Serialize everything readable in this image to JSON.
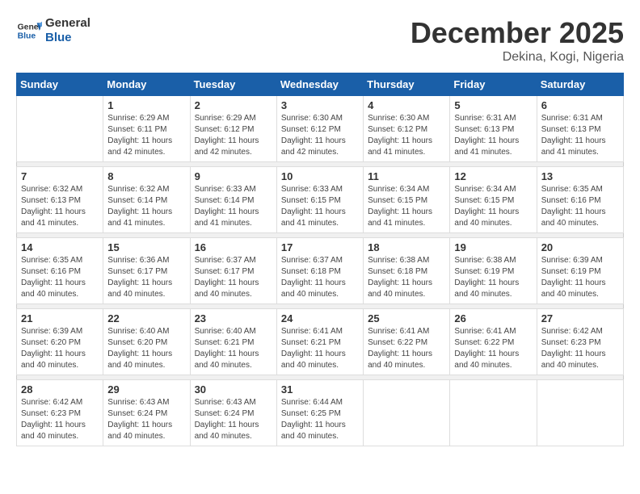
{
  "logo": {
    "line1": "General",
    "line2": "Blue"
  },
  "title": "December 2025",
  "location": "Dekina, Kogi, Nigeria",
  "days_of_week": [
    "Sunday",
    "Monday",
    "Tuesday",
    "Wednesday",
    "Thursday",
    "Friday",
    "Saturday"
  ],
  "weeks": [
    [
      {
        "day": "",
        "info": ""
      },
      {
        "day": "1",
        "info": "Sunrise: 6:29 AM\nSunset: 6:11 PM\nDaylight: 11 hours and 42 minutes."
      },
      {
        "day": "2",
        "info": "Sunrise: 6:29 AM\nSunset: 6:12 PM\nDaylight: 11 hours and 42 minutes."
      },
      {
        "day": "3",
        "info": "Sunrise: 6:30 AM\nSunset: 6:12 PM\nDaylight: 11 hours and 42 minutes."
      },
      {
        "day": "4",
        "info": "Sunrise: 6:30 AM\nSunset: 6:12 PM\nDaylight: 11 hours and 41 minutes."
      },
      {
        "day": "5",
        "info": "Sunrise: 6:31 AM\nSunset: 6:13 PM\nDaylight: 11 hours and 41 minutes."
      },
      {
        "day": "6",
        "info": "Sunrise: 6:31 AM\nSunset: 6:13 PM\nDaylight: 11 hours and 41 minutes."
      }
    ],
    [
      {
        "day": "7",
        "info": "Sunrise: 6:32 AM\nSunset: 6:13 PM\nDaylight: 11 hours and 41 minutes."
      },
      {
        "day": "8",
        "info": "Sunrise: 6:32 AM\nSunset: 6:14 PM\nDaylight: 11 hours and 41 minutes."
      },
      {
        "day": "9",
        "info": "Sunrise: 6:33 AM\nSunset: 6:14 PM\nDaylight: 11 hours and 41 minutes."
      },
      {
        "day": "10",
        "info": "Sunrise: 6:33 AM\nSunset: 6:15 PM\nDaylight: 11 hours and 41 minutes."
      },
      {
        "day": "11",
        "info": "Sunrise: 6:34 AM\nSunset: 6:15 PM\nDaylight: 11 hours and 41 minutes."
      },
      {
        "day": "12",
        "info": "Sunrise: 6:34 AM\nSunset: 6:15 PM\nDaylight: 11 hours and 40 minutes."
      },
      {
        "day": "13",
        "info": "Sunrise: 6:35 AM\nSunset: 6:16 PM\nDaylight: 11 hours and 40 minutes."
      }
    ],
    [
      {
        "day": "14",
        "info": "Sunrise: 6:35 AM\nSunset: 6:16 PM\nDaylight: 11 hours and 40 minutes."
      },
      {
        "day": "15",
        "info": "Sunrise: 6:36 AM\nSunset: 6:17 PM\nDaylight: 11 hours and 40 minutes."
      },
      {
        "day": "16",
        "info": "Sunrise: 6:37 AM\nSunset: 6:17 PM\nDaylight: 11 hours and 40 minutes."
      },
      {
        "day": "17",
        "info": "Sunrise: 6:37 AM\nSunset: 6:18 PM\nDaylight: 11 hours and 40 minutes."
      },
      {
        "day": "18",
        "info": "Sunrise: 6:38 AM\nSunset: 6:18 PM\nDaylight: 11 hours and 40 minutes."
      },
      {
        "day": "19",
        "info": "Sunrise: 6:38 AM\nSunset: 6:19 PM\nDaylight: 11 hours and 40 minutes."
      },
      {
        "day": "20",
        "info": "Sunrise: 6:39 AM\nSunset: 6:19 PM\nDaylight: 11 hours and 40 minutes."
      }
    ],
    [
      {
        "day": "21",
        "info": "Sunrise: 6:39 AM\nSunset: 6:20 PM\nDaylight: 11 hours and 40 minutes."
      },
      {
        "day": "22",
        "info": "Sunrise: 6:40 AM\nSunset: 6:20 PM\nDaylight: 11 hours and 40 minutes."
      },
      {
        "day": "23",
        "info": "Sunrise: 6:40 AM\nSunset: 6:21 PM\nDaylight: 11 hours and 40 minutes."
      },
      {
        "day": "24",
        "info": "Sunrise: 6:41 AM\nSunset: 6:21 PM\nDaylight: 11 hours and 40 minutes."
      },
      {
        "day": "25",
        "info": "Sunrise: 6:41 AM\nSunset: 6:22 PM\nDaylight: 11 hours and 40 minutes."
      },
      {
        "day": "26",
        "info": "Sunrise: 6:41 AM\nSunset: 6:22 PM\nDaylight: 11 hours and 40 minutes."
      },
      {
        "day": "27",
        "info": "Sunrise: 6:42 AM\nSunset: 6:23 PM\nDaylight: 11 hours and 40 minutes."
      }
    ],
    [
      {
        "day": "28",
        "info": "Sunrise: 6:42 AM\nSunset: 6:23 PM\nDaylight: 11 hours and 40 minutes."
      },
      {
        "day": "29",
        "info": "Sunrise: 6:43 AM\nSunset: 6:24 PM\nDaylight: 11 hours and 40 minutes."
      },
      {
        "day": "30",
        "info": "Sunrise: 6:43 AM\nSunset: 6:24 PM\nDaylight: 11 hours and 40 minutes."
      },
      {
        "day": "31",
        "info": "Sunrise: 6:44 AM\nSunset: 6:25 PM\nDaylight: 11 hours and 40 minutes."
      },
      {
        "day": "",
        "info": ""
      },
      {
        "day": "",
        "info": ""
      },
      {
        "day": "",
        "info": ""
      }
    ]
  ]
}
